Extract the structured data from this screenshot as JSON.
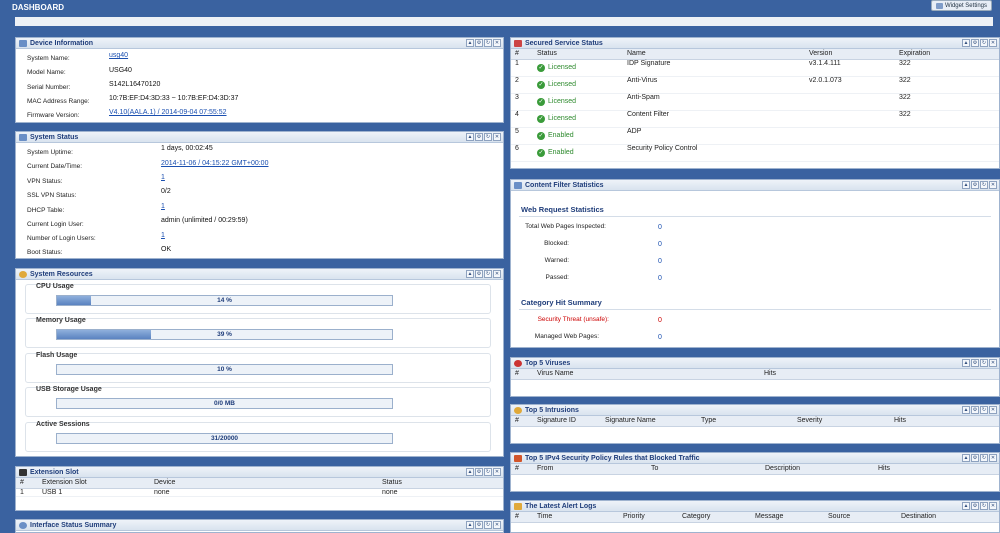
{
  "page_title": "DASHBOARD",
  "widget_settings": "Widget Settings",
  "panel_controls": [
    "▲",
    "⚙",
    "↻",
    "✕"
  ],
  "device_info": {
    "title": "Device Information",
    "rows": [
      {
        "label": "System Name:",
        "value": "usg40",
        "link": true
      },
      {
        "label": "Model Name:",
        "value": "USG40",
        "link": false
      },
      {
        "label": "Serial Number:",
        "value": "S142L16470120",
        "link": false
      },
      {
        "label": "MAC Address Range:",
        "value": "10:7B:EF:D4:3D:33 ~ 10:7B:EF:D4:3D:37",
        "link": false
      },
      {
        "label": "Firmware Version:",
        "value": "V4.10(AALA.1) / 2014-09-04 07:55:52",
        "link": true
      }
    ]
  },
  "system_status": {
    "title": "System Status",
    "rows": [
      {
        "label": "System Uptime:",
        "value": "1 days, 00:02:45",
        "link": false
      },
      {
        "label": "Current Date/Time:",
        "value": "2014-11-06 / 04:15:22 GMT+00:00",
        "link": true
      },
      {
        "label": "VPN Status:",
        "value": "1",
        "link": true
      },
      {
        "label": "SSL VPN Status:",
        "value": "0/2",
        "link": false
      },
      {
        "label": "DHCP Table:",
        "value": "1",
        "link": true
      },
      {
        "label": "Current Login User:",
        "value": "admin (unlimited / 00:29:59)",
        "link": false
      },
      {
        "label": "Number of Login Users:",
        "value": "1",
        "link": true
      },
      {
        "label": "Boot Status:",
        "value": "OK",
        "link": false
      }
    ]
  },
  "system_resources": {
    "title": "System Resources",
    "items": [
      {
        "label": "CPU Usage",
        "value": "14 %",
        "fraction": 0.1
      },
      {
        "label": "Memory Usage",
        "value": "39 %",
        "fraction": 0.28
      },
      {
        "label": "Flash Usage",
        "value": "10 %",
        "fraction": 0.0
      },
      {
        "label": "USB Storage Usage",
        "value": "0/0 MB",
        "fraction": 0.0
      },
      {
        "label": "Active Sessions",
        "value": "31/20000",
        "fraction": 0.0
      }
    ]
  },
  "extension_slot": {
    "title": "Extension Slot",
    "headers": [
      "#",
      "Extension Slot",
      "Device",
      "Status"
    ],
    "rows": [
      [
        "1",
        "USB 1",
        "none",
        "none"
      ]
    ]
  },
  "interface_status": {
    "title": "Interface Status Summary"
  },
  "secured_service": {
    "title": "Secured Service Status",
    "headers": [
      "#",
      "Status",
      "Name",
      "Version",
      "Expiration"
    ],
    "rows": [
      [
        "1",
        "Licensed",
        "IDP Signature",
        "v3.1.4.111",
        "322"
      ],
      [
        "2",
        "Licensed",
        "Anti-Virus",
        "v2.0.1.073",
        "322"
      ],
      [
        "3",
        "Licensed",
        "Anti-Spam",
        "",
        "322"
      ],
      [
        "4",
        "Licensed",
        "Content Filter",
        "",
        "322"
      ],
      [
        "5",
        "Enabled",
        "ADP",
        "",
        ""
      ],
      [
        "6",
        "Enabled",
        "Security Policy Control",
        "",
        ""
      ]
    ]
  },
  "content_filter": {
    "title": "Content Filter Statistics",
    "web_heading": "Web Request Statistics",
    "web_rows": [
      {
        "label": "Total Web Pages Inspected:",
        "value": "0"
      },
      {
        "label": "Blocked:",
        "value": "0"
      },
      {
        "label": "Warned:",
        "value": "0"
      },
      {
        "label": "Passed:",
        "value": "0"
      }
    ],
    "cat_heading": "Category Hit Summary",
    "cat_rows": [
      {
        "label": "Security Threat (unsafe):",
        "value": "0",
        "color": "#cc0000"
      },
      {
        "label": "Managed Web Pages:",
        "value": "0",
        "color": "#222222"
      }
    ]
  },
  "top_viruses": {
    "title": "Top 5 Viruses",
    "headers": [
      "#",
      "Virus Name",
      "Hits"
    ]
  },
  "top_intrusions": {
    "title": "Top 5 Intrusions",
    "headers": [
      "#",
      "Signature ID",
      "Signature Name",
      "Type",
      "Severity",
      "Hits"
    ]
  },
  "top_policy": {
    "title": "Top 5 IPv4 Security Policy Rules that Blocked Traffic",
    "headers": [
      "#",
      "From",
      "To",
      "Description",
      "Hits"
    ]
  },
  "alert_logs": {
    "title": "The Latest Alert Logs",
    "headers": [
      "#",
      "Time",
      "Priority",
      "Category",
      "Message",
      "Source",
      "Destination"
    ]
  }
}
